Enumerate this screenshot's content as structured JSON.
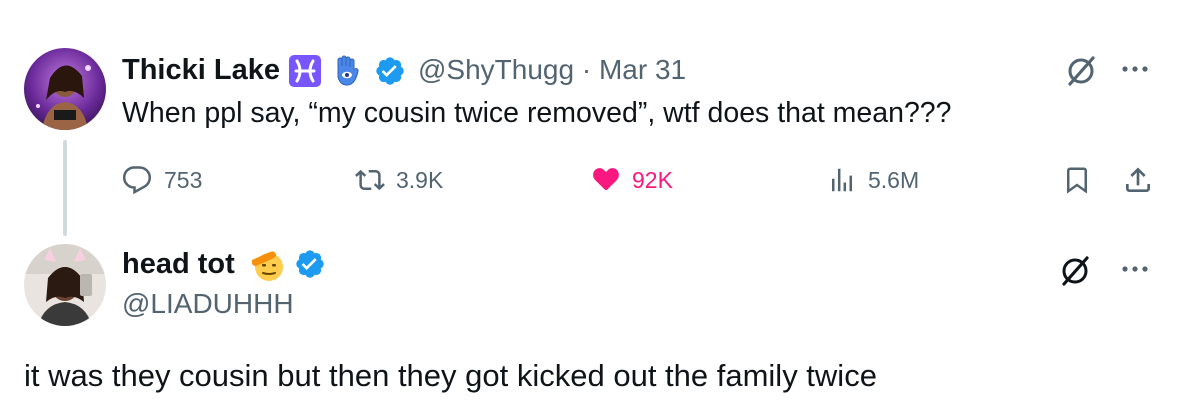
{
  "tweet": {
    "author_name": "Thicki Lake",
    "author_handle": "@ShyThugg",
    "separator": "·",
    "date": "Mar 31",
    "text": "When ppl say, “my cousin twice removed”, wtf does that mean???",
    "metrics": {
      "replies": "753",
      "retweets": "3.9K",
      "likes": "92K",
      "views": "5.6M"
    },
    "like_color": "#f91880"
  },
  "reply": {
    "author_name": "head tot",
    "author_handle": "@LIADUHHH",
    "text": "it was they cousin but then they got kicked out the family twice"
  },
  "colors": {
    "verified": "#1d9bf0",
    "muted": "#536471",
    "thread_line": "#cfd9de",
    "pisces_badge": "#7856ff"
  }
}
